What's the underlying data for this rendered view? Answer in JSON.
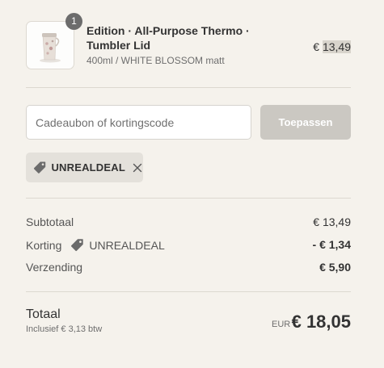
{
  "product": {
    "quantity": "1",
    "name": "Edition · All-Purpose Thermo · Tumbler Lid",
    "variant": "400ml / WHITE BLOSSOM matt",
    "price_currency": "€ ",
    "price_amount": "13,49"
  },
  "discount": {
    "placeholder": "Cadeaubon of kortingscode",
    "apply_label": "Toepassen",
    "applied_code": "UNREALDEAL"
  },
  "summary": {
    "subtotal_label": "Subtotaal",
    "subtotal_value": "€ 13,49",
    "discount_label": "Korting",
    "discount_code": "UNREALDEAL",
    "discount_value": "- € 1,34",
    "shipping_label": "Verzending",
    "shipping_value": "€ 5,90"
  },
  "total": {
    "label": "Totaal",
    "tax_note": "Inclusief € 3,13 btw",
    "currency": "EUR",
    "value": "€ 18,05"
  },
  "icons": {
    "tag": "tag-icon",
    "remove": "close-icon",
    "product": "tumbler-image"
  },
  "colors": {
    "background": "#f5f2ec",
    "button_disabled": "#cbc8c2",
    "chip": "#e4e1db",
    "badge": "#6c6c6c"
  }
}
